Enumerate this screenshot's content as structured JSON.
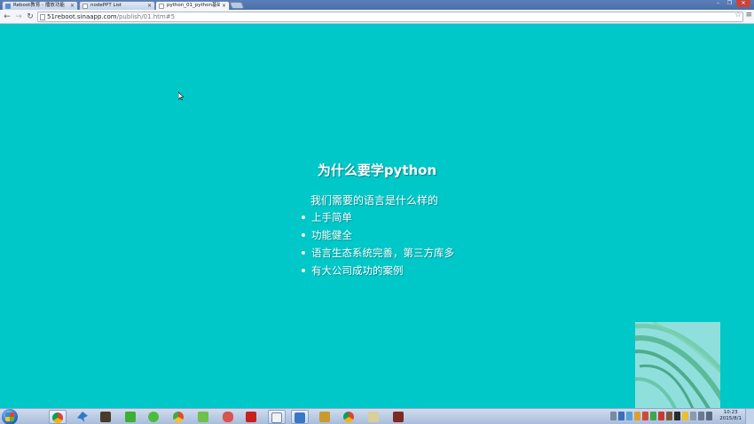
{
  "browser": {
    "tabs": [
      {
        "title": "Reboot教育 - 播放功能",
        "active": false
      },
      {
        "title": "nodePPT List",
        "active": false
      },
      {
        "title": "python_01_python基础",
        "active": true
      }
    ],
    "url_host": "51reboot.sinaapp.com",
    "url_path": "/publish/01.htm#5"
  },
  "slide": {
    "title": "为什么要学python",
    "subtitle": "我们需要的语言是什么样的",
    "bullets": [
      "上手简单",
      "功能健全",
      "语言生态系统完善，第三方库多",
      "有大公司成功的案例"
    ],
    "background_color": "#00c7c8"
  },
  "taskbar": {
    "clock_time": "10:23",
    "clock_date": "2015/8/1",
    "apps": [
      "chrome-icon",
      "bird-icon",
      "media-icon",
      "iqiyi-icon",
      "360-browser-icon",
      "chrome-alt-icon",
      "green-app-icon",
      "game-icon",
      "pdf-icon",
      "document-icon",
      "window-icon",
      "folder-icon",
      "archive-icon",
      "chrome-icon",
      "notes-icon",
      "video-app-icon"
    ]
  }
}
